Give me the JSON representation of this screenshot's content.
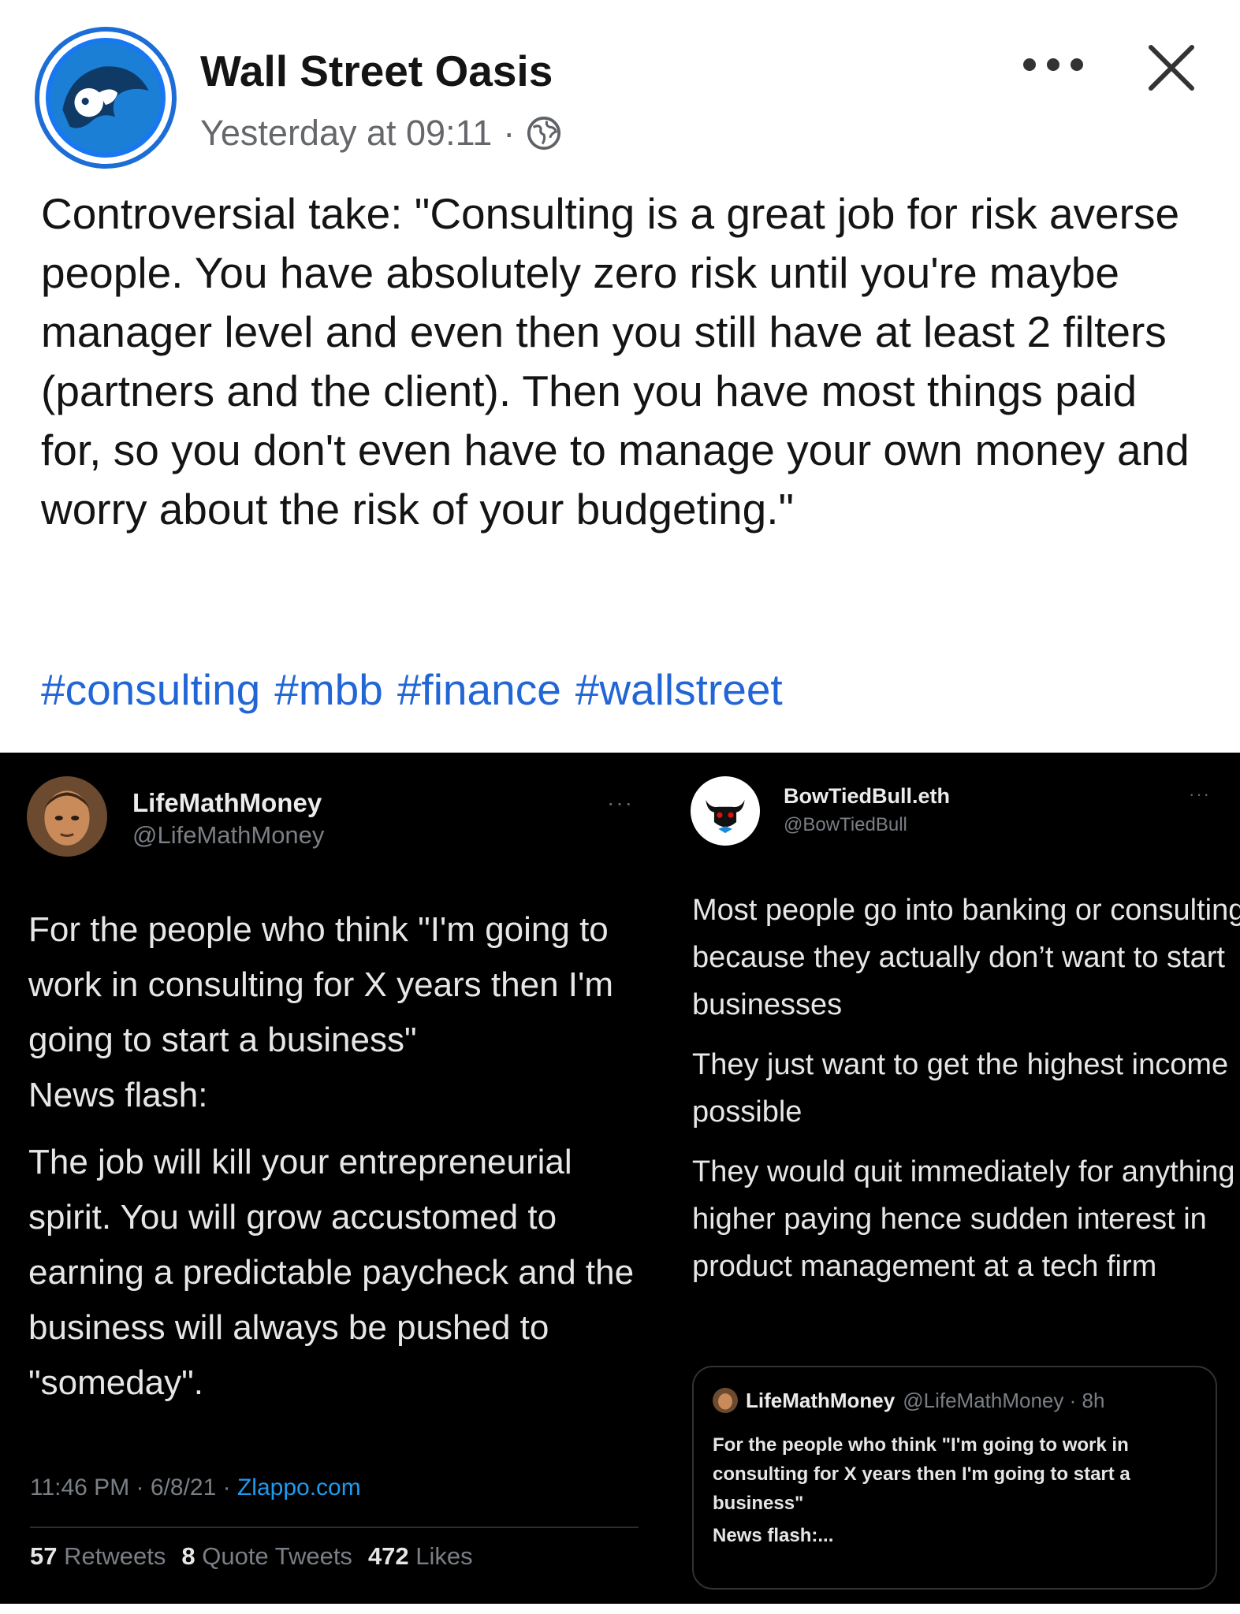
{
  "post": {
    "page_name": "Wall Street Oasis",
    "timestamp": "Yesterday at 09:11",
    "separator": "·",
    "privacy_icon": "globe-icon",
    "more_icon": "more-horizontal-icon",
    "close_icon": "close-icon",
    "text": "Controversial take: \"Consulting is a great job for risk averse people. You have absolutely zero risk until you're maybe manager level and even then you still have at least 2 filters (partners and the client). Then you have most things paid for, so you don't even have to manage your own money and worry about the risk of your budgeting.\"",
    "hashtags": [
      "#consulting",
      "#mbb",
      "#finance",
      "#wallstreet"
    ],
    "colors": {
      "link": "#2266d6",
      "brand": "#1877f2"
    }
  },
  "tweet_left": {
    "name": "LifeMathMoney",
    "handle": "@LifeMathMoney",
    "more": "···",
    "paragraphs": [
      "For the people who think \"I'm going to work in consulting for X years then I'm going to start a business\"",
      "News flash:",
      "The job will kill your entrepreneurial spirit. You will grow accustomed to earning a predictable paycheck and the business will always be pushed to \"someday\"."
    ],
    "time": "11:46 PM",
    "date": "6/8/21",
    "source": "Zlappo.com",
    "dot": "·",
    "stats": {
      "retweets_count": "57",
      "retweets_label": "Retweets",
      "quotes_count": "8",
      "quotes_label": "Quote Tweets",
      "likes_count": "472",
      "likes_label": "Likes"
    }
  },
  "tweet_right": {
    "name": "BowTiedBull.eth",
    "handle": "@BowTiedBull",
    "more": "···",
    "paragraphs": [
      "Most people go into banking or consulting because they actually don’t want to start businesses",
      "They just want to get the highest income possible",
      "They would quit immediately for anything higher paying hence sudden interest in product management at a tech firm"
    ],
    "quote": {
      "name": "LifeMathMoney",
      "handle_time": "@LifeMathMoney · 8h",
      "text": "For the people who think \"I'm going to work in consulting for X years then I'm going to start a business\"",
      "more_text": "News flash:..."
    }
  }
}
